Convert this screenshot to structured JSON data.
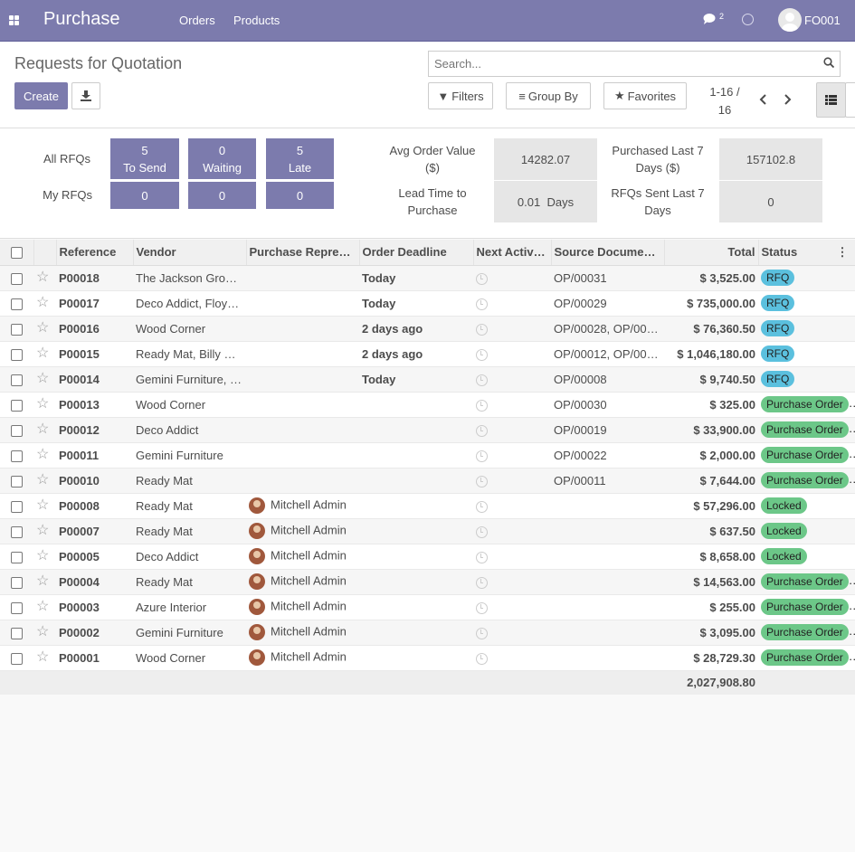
{
  "app": {
    "title": "Purchase",
    "menu": [
      "Orders",
      "Products"
    ],
    "chat_count": "2",
    "user": "FO001"
  },
  "control": {
    "breadcrumb": "Requests for Quotation",
    "create_label": "Create",
    "search_placeholder": "Search...",
    "filters_label": "Filters",
    "groupby_label": "Group By",
    "favorites_label": "Favorites",
    "pager_line1": "1-16 /",
    "pager_line2": "16"
  },
  "dashboard": {
    "all_rfqs_label": "All RFQs",
    "my_rfqs_label": "My RFQs",
    "all": [
      {
        "value": "5",
        "label": "To Send"
      },
      {
        "value": "0",
        "label": "Waiting"
      },
      {
        "value": "5",
        "label": "Late"
      }
    ],
    "my": [
      "0",
      "0",
      "0"
    ],
    "stats": [
      {
        "label_1": "Avg Order Value",
        "label_2": "($)",
        "value": "14282.07"
      },
      {
        "label_1": "Purchased Last 7",
        "label_2": "Days ($)",
        "value": "157102.8"
      },
      {
        "label_1": "Lead Time to",
        "label_2": "Purchase",
        "value": "0.01  Days"
      },
      {
        "label_1": "RFQs Sent Last 7",
        "label_2": "Days",
        "value": "0"
      }
    ]
  },
  "table": {
    "columns": [
      "Reference",
      "Vendor",
      "Purchase Repre…",
      "Order Deadline",
      "Next Activ…",
      "Source Docume…",
      "Total",
      "Status"
    ],
    "rows": [
      {
        "ref": "P00018",
        "vendor": "The Jackson Gro…",
        "rep": "",
        "deadline": "Today",
        "dl": "today",
        "source": "OP/00031",
        "total": "$ 3,525.00",
        "status": "RFQ",
        "st": "rfq"
      },
      {
        "ref": "P00017",
        "vendor": "Deco Addict, Floy…",
        "rep": "",
        "deadline": "Today",
        "dl": "today",
        "source": "OP/00029",
        "total": "$ 735,000.00",
        "status": "RFQ",
        "st": "rfq"
      },
      {
        "ref": "P00016",
        "vendor": "Wood Corner",
        "rep": "",
        "deadline": "2 days ago",
        "dl": "late",
        "source": "OP/00028, OP/00…",
        "total": "$ 76,360.50",
        "status": "RFQ",
        "st": "rfq"
      },
      {
        "ref": "P00015",
        "vendor": "Ready Mat, Billy …",
        "rep": "",
        "deadline": "2 days ago",
        "dl": "late",
        "source": "OP/00012, OP/00…",
        "total": "$ 1,046,180.00",
        "status": "RFQ",
        "st": "rfq"
      },
      {
        "ref": "P00014",
        "vendor": "Gemini Furniture, …",
        "rep": "",
        "deadline": "Today",
        "dl": "today",
        "source": "OP/00008",
        "total": "$ 9,740.50",
        "status": "RFQ",
        "st": "rfq"
      },
      {
        "ref": "P00013",
        "vendor": "Wood Corner",
        "rep": "",
        "deadline": "",
        "dl": "",
        "source": "OP/00030",
        "total": "$ 325.00",
        "status": "Purchase Order",
        "st": "po"
      },
      {
        "ref": "P00012",
        "vendor": "Deco Addict",
        "rep": "",
        "deadline": "",
        "dl": "",
        "source": "OP/00019",
        "total": "$ 33,900.00",
        "status": "Purchase Order",
        "st": "po"
      },
      {
        "ref": "P00011",
        "vendor": "Gemini Furniture",
        "rep": "",
        "deadline": "",
        "dl": "",
        "source": "OP/00022",
        "total": "$ 2,000.00",
        "status": "Purchase Order",
        "st": "po"
      },
      {
        "ref": "P00010",
        "vendor": "Ready Mat",
        "rep": "",
        "deadline": "",
        "dl": "",
        "source": "OP/00011",
        "total": "$ 7,644.00",
        "status": "Purchase Order",
        "st": "po"
      },
      {
        "ref": "P00008",
        "vendor": "Ready Mat",
        "rep": "Mitchell Admin",
        "deadline": "",
        "dl": "",
        "source": "",
        "total": "$ 57,296.00",
        "status": "Locked",
        "st": "locked"
      },
      {
        "ref": "P00007",
        "vendor": "Ready Mat",
        "rep": "Mitchell Admin",
        "deadline": "",
        "dl": "",
        "source": "",
        "total": "$ 637.50",
        "status": "Locked",
        "st": "locked"
      },
      {
        "ref": "P00005",
        "vendor": "Deco Addict",
        "rep": "Mitchell Admin",
        "deadline": "",
        "dl": "",
        "source": "",
        "total": "$ 8,658.00",
        "status": "Locked",
        "st": "locked"
      },
      {
        "ref": "P00004",
        "vendor": "Ready Mat",
        "rep": "Mitchell Admin",
        "deadline": "",
        "dl": "",
        "source": "",
        "total": "$ 14,563.00",
        "status": "Purchase Order",
        "st": "po"
      },
      {
        "ref": "P00003",
        "vendor": "Azure Interior",
        "rep": "Mitchell Admin",
        "deadline": "",
        "dl": "",
        "source": "",
        "total": "$ 255.00",
        "status": "Purchase Order",
        "st": "po"
      },
      {
        "ref": "P00002",
        "vendor": "Gemini Furniture",
        "rep": "Mitchell Admin",
        "deadline": "",
        "dl": "",
        "source": "",
        "total": "$ 3,095.00",
        "status": "Purchase Order",
        "st": "po"
      },
      {
        "ref": "P00001",
        "vendor": "Wood Corner",
        "rep": "Mitchell Admin",
        "deadline": "",
        "dl": "",
        "source": "",
        "total": "$ 28,729.30",
        "status": "Purchase Order",
        "st": "po"
      }
    ],
    "grand_total": "2,027,908.80"
  }
}
